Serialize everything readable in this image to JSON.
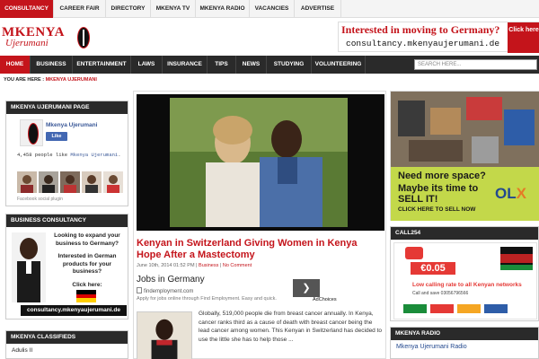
{
  "topbar": {
    "tabs": [
      {
        "label": "CONSULTANCY",
        "active": true
      },
      {
        "label": "CAREER FAIR",
        "active": false
      },
      {
        "label": "DIRECTORY",
        "active": false
      },
      {
        "label": "MKENYA TV",
        "active": false
      },
      {
        "label": "MKENYA RADIO",
        "active": false
      },
      {
        "label": "VACANCIES",
        "active": false
      },
      {
        "label": "ADVERTISE",
        "active": false
      }
    ]
  },
  "header": {
    "logo_word1": "MKENYA",
    "logo_word2": "Ujerumani",
    "banner_title": "Interested in moving to Germany?",
    "banner_url": "consultancy.mkenyaujerumani.de",
    "banner_cta": "Click here"
  },
  "nav": {
    "items": [
      {
        "label": "HOME",
        "active": true
      },
      {
        "label": "BUSINESS",
        "active": false
      },
      {
        "label": "ENTERTAINMENT",
        "active": false
      },
      {
        "label": "LAWS",
        "active": false
      },
      {
        "label": "INSURANCE",
        "active": false
      },
      {
        "label": "TIPS",
        "active": false
      },
      {
        "label": "NEWS",
        "active": false
      },
      {
        "label": "STUDYING",
        "active": false
      },
      {
        "label": "VOLUNTEERING",
        "active": false
      }
    ],
    "search_placeholder": "SEARCH HERE..."
  },
  "breadcrumb": {
    "prefix": "YOU ARE HERE :",
    "current": "MKENYA UJERUMANI"
  },
  "sidebar": {
    "fb_box": {
      "title": "MKENYA UJERUMANI PAGE",
      "page_name": "Mkenya Ujerumani",
      "like_label": "Like",
      "people_text": "4,458 people like ",
      "people_link": "Mkenya Ujerumani",
      "people_suffix": ".",
      "plugin_text": "Facebook social plugin"
    },
    "business_box": {
      "title": "BUSINESS CONSULTANCY",
      "q1": "Looking to expand your business to Germany?",
      "q2": "Interested in German products for your business?",
      "cta": "Click here:",
      "url": "consultancy.mkenyaujerumani.de"
    },
    "classifieds_box": {
      "title": "MKENYA CLASSIFIEDS",
      "first_item": "Adulis II"
    }
  },
  "article": {
    "title": "Kenyan in Switzerland Giving Women in Kenya Hope After a Mastectomy",
    "date": "June 10th, 2014 01:52 PM",
    "separator": " | ",
    "category": "Business",
    "comments": "No Comment",
    "ad_headline": "Jobs in Germany",
    "ad_domain": "findemployment.com",
    "ad_desc": "Apply for jobs online through Find Employment. Easy and quick.",
    "ad_choices": "AdChoices",
    "excerpt": "Globally, 519,000 people die from breast cancer annually. In Kenya, cancer ranks third as a cause of death with breast cancer being the lead cancer among women. This Kenyan in Switzerland has decided to use the little she has to help those ..."
  },
  "right": {
    "olx_line1": "Need more space?",
    "olx_line2": "Maybe its time to SELL IT!",
    "olx_line3": "CLICK HERE TO SELL NOW",
    "olx_logo_a": "OL",
    "olx_logo_b": "X",
    "call_title": "CALL254",
    "call_price": "0.05",
    "call_low": "Low calling rate to all Kenyan networks",
    "call_save": "Call and save 03056796566",
    "radio_title": "MKENYA RADIO",
    "radio_link": "Mkenya Ujerumani Radio"
  },
  "colors": {
    "brand_red": "#c4141b",
    "nav_dark": "#2a2a2a",
    "facebook_blue": "#3b5998",
    "olx_green": "#c3d84a"
  }
}
